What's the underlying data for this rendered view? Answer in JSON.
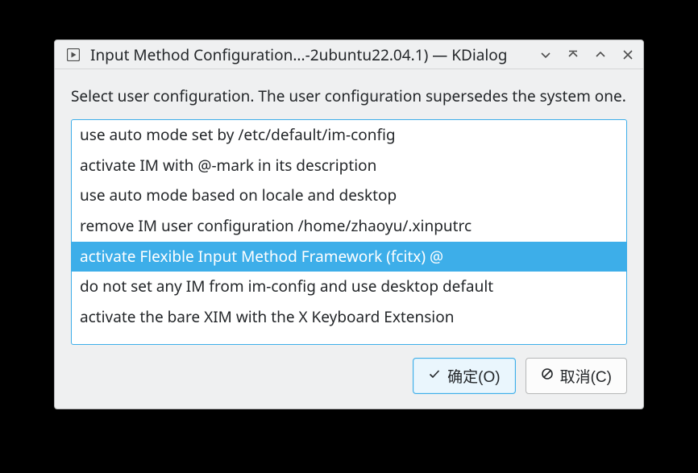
{
  "window": {
    "title": "Input Method Configuration...-2ubuntu22.04.1) — KDialog"
  },
  "content": {
    "instruction": "Select user configuration. The user configuration supersedes the system one.",
    "options": [
      "use auto mode set by /etc/default/im-config",
      "activate IM with @-mark in its description",
      "use auto mode based on locale and desktop",
      "remove IM user configuration /home/zhaoyu/.xinputrc",
      "activate Flexible Input Method Framework (fcitx) @",
      "do not set any IM from im-config and use desktop default",
      "activate the bare XIM with the X Keyboard Extension"
    ],
    "selected_index": 4
  },
  "buttons": {
    "ok_label": "确定(O)",
    "cancel_label": "取消(C)"
  }
}
